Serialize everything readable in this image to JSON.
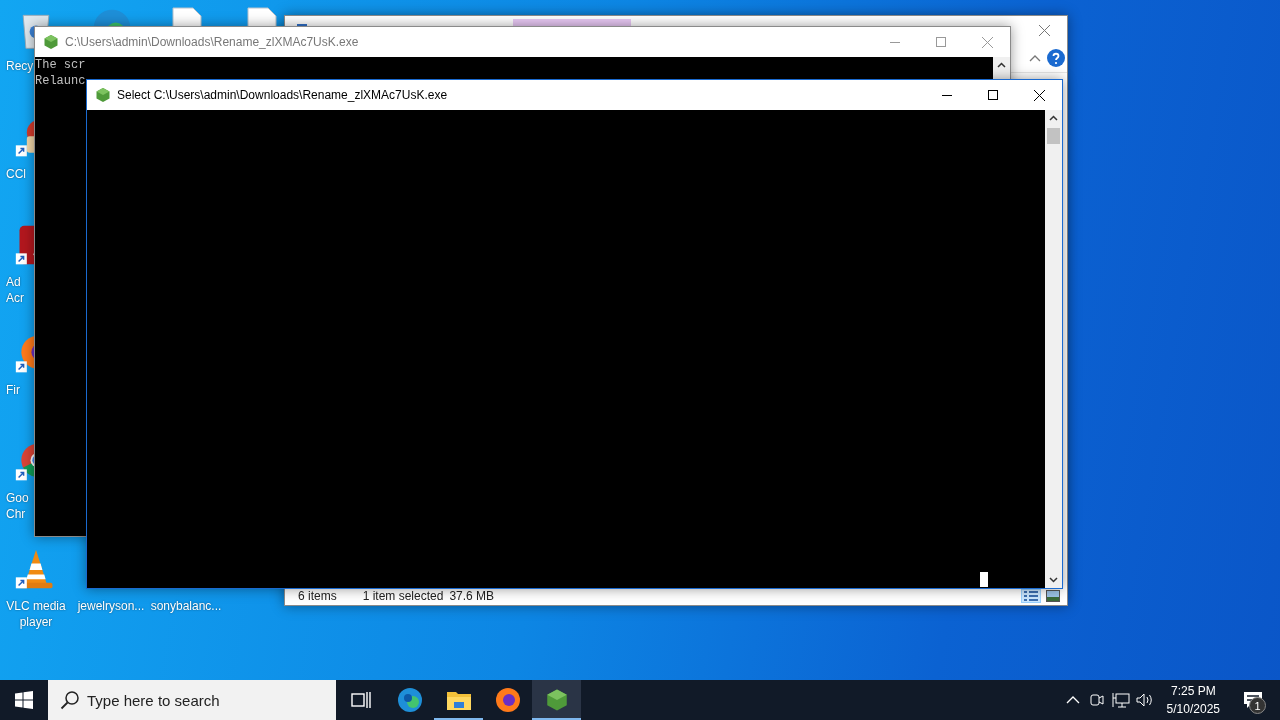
{
  "desktop_icons": [
    {
      "kind": "recycle-bin",
      "lines": [
        "Recy"
      ]
    },
    {
      "kind": "ccleaner",
      "lines": [
        "CCl"
      ]
    },
    {
      "kind": "acrobat",
      "lines": [
        "Ad",
        "Acr"
      ]
    },
    {
      "kind": "firefox",
      "lines": [
        "Fir"
      ]
    },
    {
      "kind": "chrome",
      "lines": [
        "Goo",
        "Chr"
      ]
    },
    {
      "kind": "vlc",
      "lines": [
        "VLC media",
        "player"
      ]
    },
    {
      "kind": "edge"
    },
    {
      "kind": "document"
    },
    {
      "kind": "document"
    },
    {
      "kind": "hidden",
      "lines": [
        "jewelryson..."
      ]
    },
    {
      "kind": "hidden",
      "lines": [
        "sonybalanc..."
      ]
    }
  ],
  "explorer": {
    "status_count": "6 items",
    "status_selected": "1 item selected",
    "status_size": "37.6 MB"
  },
  "console_back": {
    "title": "C:\\Users\\admin\\Downloads\\Rename_zlXMAc7UsK.exe",
    "active": false,
    "lines": [
      "The scr",
      "Relaunc"
    ]
  },
  "console_front": {
    "title": "Select C:\\Users\\admin\\Downloads\\Rename_zlXMAc7UsK.exe",
    "active": true
  },
  "taskbar": {
    "search_placeholder": "Type here to search",
    "apps": [
      {
        "kind": "task-view",
        "running": false,
        "selected": false
      },
      {
        "kind": "edge",
        "running": false,
        "selected": false
      },
      {
        "kind": "explorer",
        "running": true,
        "selected": false
      },
      {
        "kind": "firefox",
        "running": false,
        "selected": false
      },
      {
        "kind": "console",
        "running": true,
        "selected": true
      }
    ],
    "time": "7:25 PM",
    "date": "5/10/2025",
    "notifications": "1"
  }
}
